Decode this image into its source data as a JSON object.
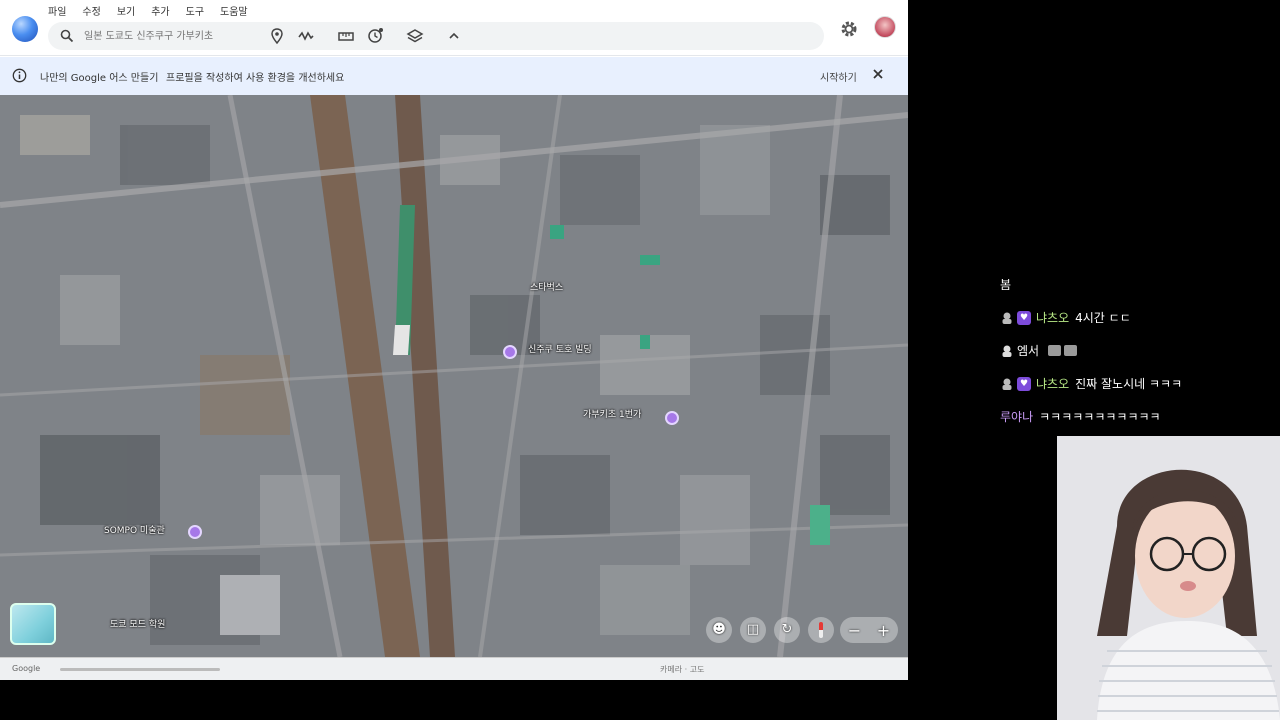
{
  "menu": [
    "파일",
    "수정",
    "보기",
    "추가",
    "도구",
    "도움말"
  ],
  "search": {
    "placeholder": "일본 도쿄도 신주쿠구 가부키초"
  },
  "banner": {
    "title": "나만의 Google 어스 만들기",
    "text": "프로필을 작성하여 사용 환경을 개선하세요",
    "action": "시작하기"
  },
  "map": {
    "labels": [
      "SOMPO 미술관",
      "도쿄 모드 학원",
      "신주쿠 토호 빌딩",
      "가부키초 1번가",
      "스타벅스"
    ],
    "status_left": "Google",
    "status_right": "카메라 · 고도"
  },
  "icons": {
    "toolbar": [
      "location-pin-icon",
      "path-icon",
      "ruler-icon",
      "history-icon",
      "layers-icon",
      "chevron-up-icon"
    ],
    "map_controls": [
      "pegman-icon",
      "3d-icon",
      "rotate-icon",
      "compass-icon"
    ]
  },
  "chat": {
    "lines": [
      {
        "user": "",
        "text": "봄",
        "user_color": "#ffffff",
        "has_badge": false
      },
      {
        "user": "냐츠오",
        "text": "4시간 ㄷㄷ",
        "user_color": "#b8e986",
        "has_badge": true
      },
      {
        "user": "",
        "text": "엠서",
        "user_color": "#ffffff",
        "has_badge": false,
        "emotes": 2,
        "icon_only": true
      },
      {
        "user": "냐츠오",
        "text": "진짜 잘노시네 ㅋㅋㅋ",
        "user_color": "#b8e986",
        "has_badge": true
      },
      {
        "user": "루야나",
        "text": "ㅋㅋㅋㅋㅋㅋㅋㅋㅋㅋㅋ",
        "user_color": "#c89bf5",
        "has_badge": false,
        "no_icon": true
      }
    ]
  },
  "colors": {
    "banner_bg": "#e8f0fe",
    "accent": "#7d4cdb",
    "chat_green": "#b8e986",
    "chat_purple": "#c89bf5"
  }
}
